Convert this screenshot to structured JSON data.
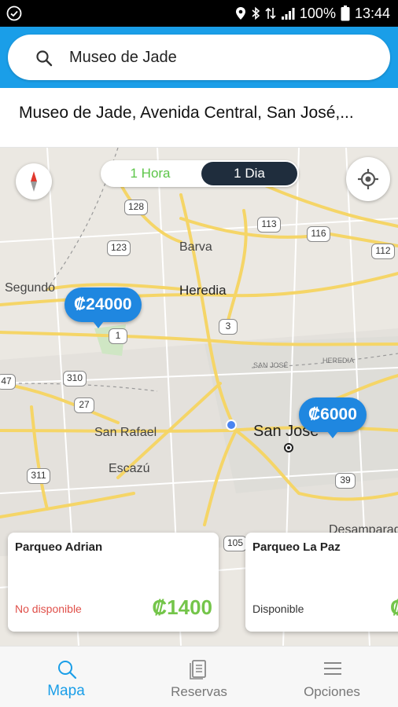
{
  "status_bar": {
    "battery": "100%",
    "time": "13:44"
  },
  "search": {
    "value": "Museo de Jade",
    "placeholder": ""
  },
  "suggestion": "Museo de Jade, Avenida Central, San José,...",
  "time_toggle": {
    "options": [
      "1 Hora",
      "1 Dia"
    ],
    "selected": "1 Dia"
  },
  "map": {
    "place_labels": [
      "Barva",
      "Heredia",
      "Segundo",
      "San Rafael",
      "Escazú",
      "San José",
      "Desamparad"
    ],
    "route_shields": [
      "128",
      "113",
      "116",
      "112",
      "123",
      "3",
      "1",
      "310",
      "27",
      "47",
      "311",
      "39",
      "105"
    ],
    "road_labels": [
      "SAN JOSÉ",
      "HEREDIA"
    ],
    "price_pins": [
      "₡24000",
      "₡6000"
    ]
  },
  "cards": [
    {
      "name": "Parqueo Adrian",
      "status": "No disponible",
      "price": "₡1400"
    },
    {
      "name": "Parqueo La Paz",
      "status": "Disponible",
      "price": "₡"
    }
  ],
  "bottom_nav": [
    {
      "label": "Mapa",
      "icon": "search-icon",
      "active": true
    },
    {
      "label": "Reservas",
      "icon": "document-icon",
      "active": false
    },
    {
      "label": "Opciones",
      "icon": "menu-icon",
      "active": false
    }
  ],
  "colors": {
    "header_blue": "#1a9ee8",
    "pin_blue": "#1f87e0",
    "price_green": "#74c54a",
    "unavailable_red": "#e0504a",
    "toggle_dark": "#1f2d3d"
  }
}
